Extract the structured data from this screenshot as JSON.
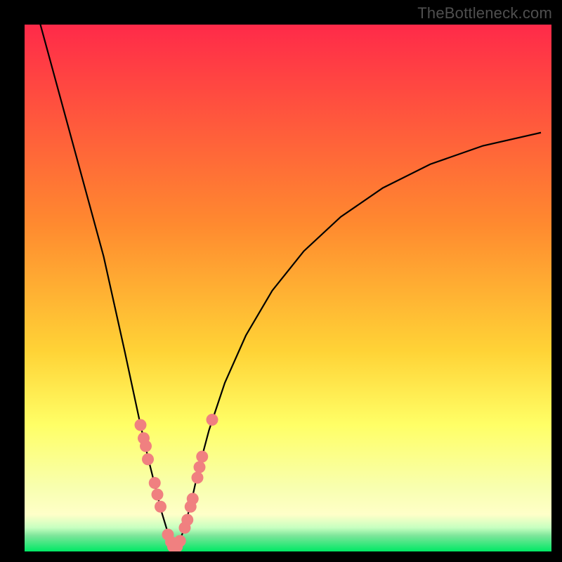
{
  "watermark": "TheBottleneck.com",
  "palette": {
    "black": "#000000",
    "gradient_top": "#ff2a49",
    "gradient_mid1": "#ff8a2f",
    "gradient_mid2": "#ffd336",
    "gradient_mid3": "#ffff66",
    "gradient_low": "#f8ffb0",
    "gradient_band": "#9affaf",
    "gradient_bottom": "#00e865",
    "curve": "#000000",
    "dot_fill": "#f08080",
    "dot_stroke": "#d86e6e"
  },
  "chart_data": {
    "type": "line",
    "title": "",
    "xlabel": "",
    "ylabel": "",
    "xlim": [
      0,
      100
    ],
    "ylim": [
      0,
      100
    ],
    "note": "Axes unlabeled; values are positions read off the image (0–100 each axis, origin bottom-left of colored area). Curve is a V-shaped bottleneck curve. Dots cluster near the valley.",
    "series": [
      {
        "name": "bottleneck-curve",
        "x": [
          0,
          3,
          6,
          9,
          12,
          15,
          17,
          19,
          20.5,
          22,
          23.5,
          25,
          26,
          27,
          27.8,
          28.5,
          29.2,
          30,
          31,
          32,
          33,
          35,
          38,
          42,
          47,
          53,
          60,
          68,
          77,
          87,
          98
        ],
        "y": [
          110,
          100,
          89,
          78,
          67,
          56,
          47,
          38,
          31,
          24,
          17.5,
          11.5,
          7.5,
          4.2,
          2.0,
          0.8,
          1.6,
          3.5,
          7.0,
          11.0,
          15.5,
          23.0,
          32.0,
          41.0,
          49.5,
          57.0,
          63.5,
          69.0,
          73.5,
          77.0,
          79.5
        ]
      }
    ],
    "scatter": [
      {
        "name": "data-points",
        "points": [
          {
            "x": 22.0,
            "y": 24.0
          },
          {
            "x": 22.6,
            "y": 21.5
          },
          {
            "x": 23.0,
            "y": 20.0
          },
          {
            "x": 23.4,
            "y": 17.5
          },
          {
            "x": 24.7,
            "y": 13.0
          },
          {
            "x": 25.2,
            "y": 10.8
          },
          {
            "x": 25.8,
            "y": 8.5
          },
          {
            "x": 27.2,
            "y": 3.2
          },
          {
            "x": 27.8,
            "y": 1.8
          },
          {
            "x": 28.2,
            "y": 0.9
          },
          {
            "x": 28.9,
            "y": 0.9
          },
          {
            "x": 29.5,
            "y": 2.0
          },
          {
            "x": 30.4,
            "y": 4.5
          },
          {
            "x": 30.9,
            "y": 6.0
          },
          {
            "x": 31.5,
            "y": 8.5
          },
          {
            "x": 31.9,
            "y": 10.0
          },
          {
            "x": 32.8,
            "y": 14.0
          },
          {
            "x": 33.2,
            "y": 16.0
          },
          {
            "x": 33.7,
            "y": 18.0
          },
          {
            "x": 35.6,
            "y": 25.0
          }
        ]
      }
    ],
    "gradient_bands_y_pct_from_top": [
      {
        "stop": 0,
        "color": "#ff2a49"
      },
      {
        "stop": 38,
        "color": "#ff8a2f"
      },
      {
        "stop": 62,
        "color": "#ffd336"
      },
      {
        "stop": 76,
        "color": "#ffff66"
      },
      {
        "stop": 88,
        "color": "#f8ffb0"
      },
      {
        "stop": 93,
        "color": "#ffffc8"
      },
      {
        "stop": 95.5,
        "color": "#c6ffc0"
      },
      {
        "stop": 97,
        "color": "#7de69a"
      },
      {
        "stop": 100,
        "color": "#00e865"
      }
    ]
  }
}
